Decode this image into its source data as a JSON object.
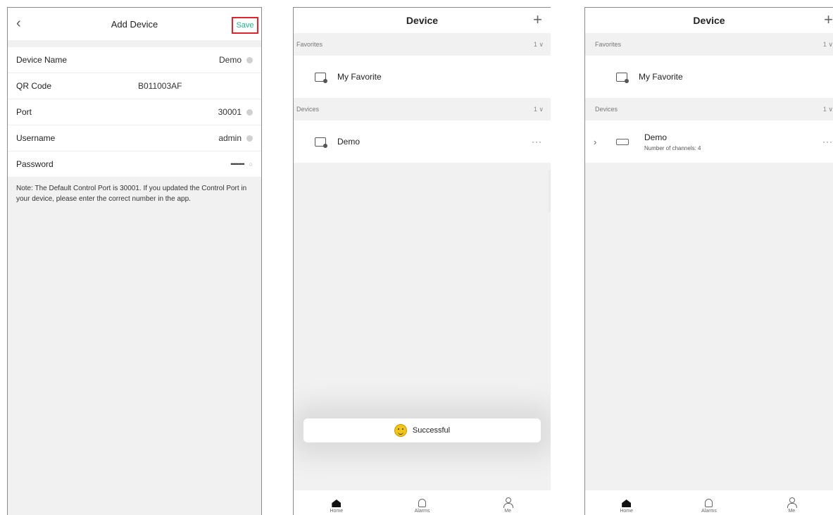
{
  "add_device": {
    "back_icon": "chevron-left-icon",
    "title": "Add Device",
    "save_label": "Save",
    "fields": [
      {
        "label": "Device Name",
        "value": "Demo"
      },
      {
        "label": "QR Code",
        "value": "B011003AF"
      },
      {
        "label": "Port",
        "value": "30001"
      },
      {
        "label": "Username",
        "value": "admin"
      },
      {
        "label": "Password",
        "value": "•••••••••"
      }
    ],
    "note": "Note: The Default Control Port is 30001. If you updated the Control Port in your device, please enter the correct number in the app."
  },
  "device_list_1": {
    "title": "Device",
    "add_label": "+",
    "favorites_label": "Favorites",
    "favorites_count": "1",
    "favorite_name": "My Favorite",
    "devices_label": "Devices",
    "devices_count": "1",
    "device_name": "Demo",
    "more_label": "···",
    "toast_text": "Successful"
  },
  "device_list_2": {
    "title": "Device",
    "add_label": "+",
    "favorites_label": "Favorites",
    "favorites_count": "1",
    "favorite_name": "My Favorite",
    "devices_label": "Devices",
    "devices_count": "1",
    "device_name": "Demo",
    "device_sub": "Number of channels: 4",
    "more_label": "···"
  },
  "tabs": [
    {
      "label": "Home",
      "icon": "home-icon"
    },
    {
      "label": "Alarms",
      "icon": "bell-icon"
    },
    {
      "label": "Me",
      "icon": "user-icon"
    }
  ],
  "colors": {
    "accent": "#1fb38a",
    "highlight_border": "#e0262d"
  }
}
